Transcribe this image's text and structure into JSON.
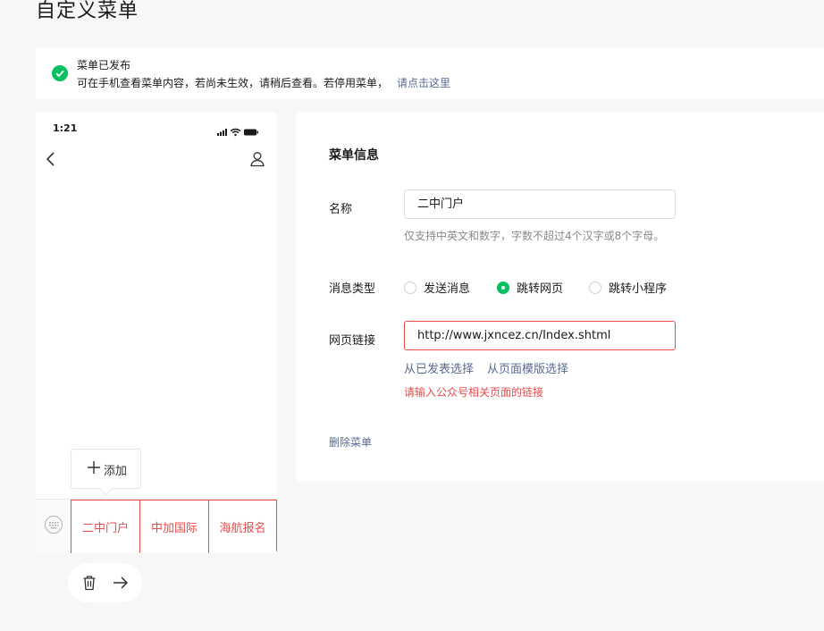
{
  "page": {
    "title": "自定义菜单"
  },
  "notice": {
    "title": "菜单已发布",
    "body": "可在手机查看菜单内容，若尚未生效，请稍后查看。若停用菜单，",
    "link": "请点击这里"
  },
  "phone": {
    "time": "1:21",
    "add_label": "添加",
    "menu_items": [
      "二中门户",
      "中加国际",
      "海航报名"
    ]
  },
  "panel": {
    "title": "菜单信息",
    "name_label": "名称",
    "name_value": "二中门户",
    "name_hint": "仅支持中英文和数字，字数不超过4个汉字或8个字母。",
    "type_label": "消息类型",
    "type_options": [
      "发送消息",
      "跳转网页",
      "跳转小程序"
    ],
    "type_selected": "跳转网页",
    "link_label": "网页链接",
    "link_value": "http://www.jxncez.cn/Index.shtml",
    "link_option_1": "从已发表选择",
    "link_option_2": "从页面模版选择",
    "link_error": "请输入公众号相关页面的链接",
    "delete_label": "删除菜单"
  },
  "colors": {
    "accent": "#07c160",
    "error": "#e84c4c",
    "link": "#576b95"
  },
  "icons": [
    "check-circle-icon",
    "signal-icon",
    "wifi-icon",
    "battery-icon",
    "back-icon",
    "user-icon",
    "plus-icon",
    "keyboard-icon",
    "trash-icon",
    "arrow-right-icon"
  ]
}
